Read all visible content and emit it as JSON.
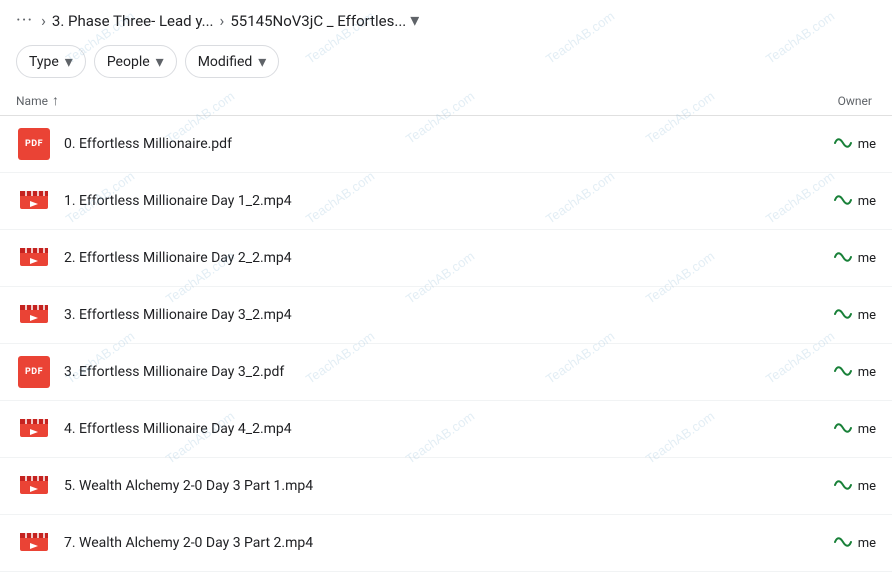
{
  "breadcrumb": {
    "dots": "···",
    "chevron": "›",
    "item1": "3. Phase Three- Lead y...",
    "item2": "55145NoV3jC _ Effortles... ",
    "dropdown_char": "▾"
  },
  "filters": [
    {
      "id": "type",
      "label": "Type",
      "chevron": "▾"
    },
    {
      "id": "people",
      "label": "People",
      "chevron": "▾"
    },
    {
      "id": "modified",
      "label": "Modified",
      "chevron": "▾"
    }
  ],
  "table_header": {
    "name_col": "Name",
    "sort_icon": "↑",
    "owner_col": "Owner"
  },
  "files": [
    {
      "id": 1,
      "type": "pdf",
      "name": "0. Effortless Millionaire.pdf",
      "owner": "me"
    },
    {
      "id": 2,
      "type": "video",
      "name": "1. Effortless Millionaire Day 1_2.mp4",
      "owner": "me"
    },
    {
      "id": 3,
      "type": "video",
      "name": "2. Effortless Millionaire Day 2_2.mp4",
      "owner": "me"
    },
    {
      "id": 4,
      "type": "video",
      "name": "3. Effortless Millionaire Day 3_2.mp4",
      "owner": "me"
    },
    {
      "id": 5,
      "type": "pdf",
      "name": "3. Effortless Millionaire Day 3_2.pdf",
      "owner": "me"
    },
    {
      "id": 6,
      "type": "video",
      "name": "4. Effortless Millionaire Day 4_2.mp4",
      "owner": "me"
    },
    {
      "id": 7,
      "type": "video",
      "name": "5. Wealth Alchemy 2-0 Day 3 Part 1.mp4",
      "owner": "me"
    },
    {
      "id": 8,
      "type": "video",
      "name": "7. Wealth Alchemy 2-0 Day 3 Part 2.mp4",
      "owner": "me"
    }
  ],
  "watermark_text": "TeachAB.com",
  "icons": {
    "pdf_label": "PDF",
    "sync_icon": "↙",
    "video_icon": "🎬"
  }
}
